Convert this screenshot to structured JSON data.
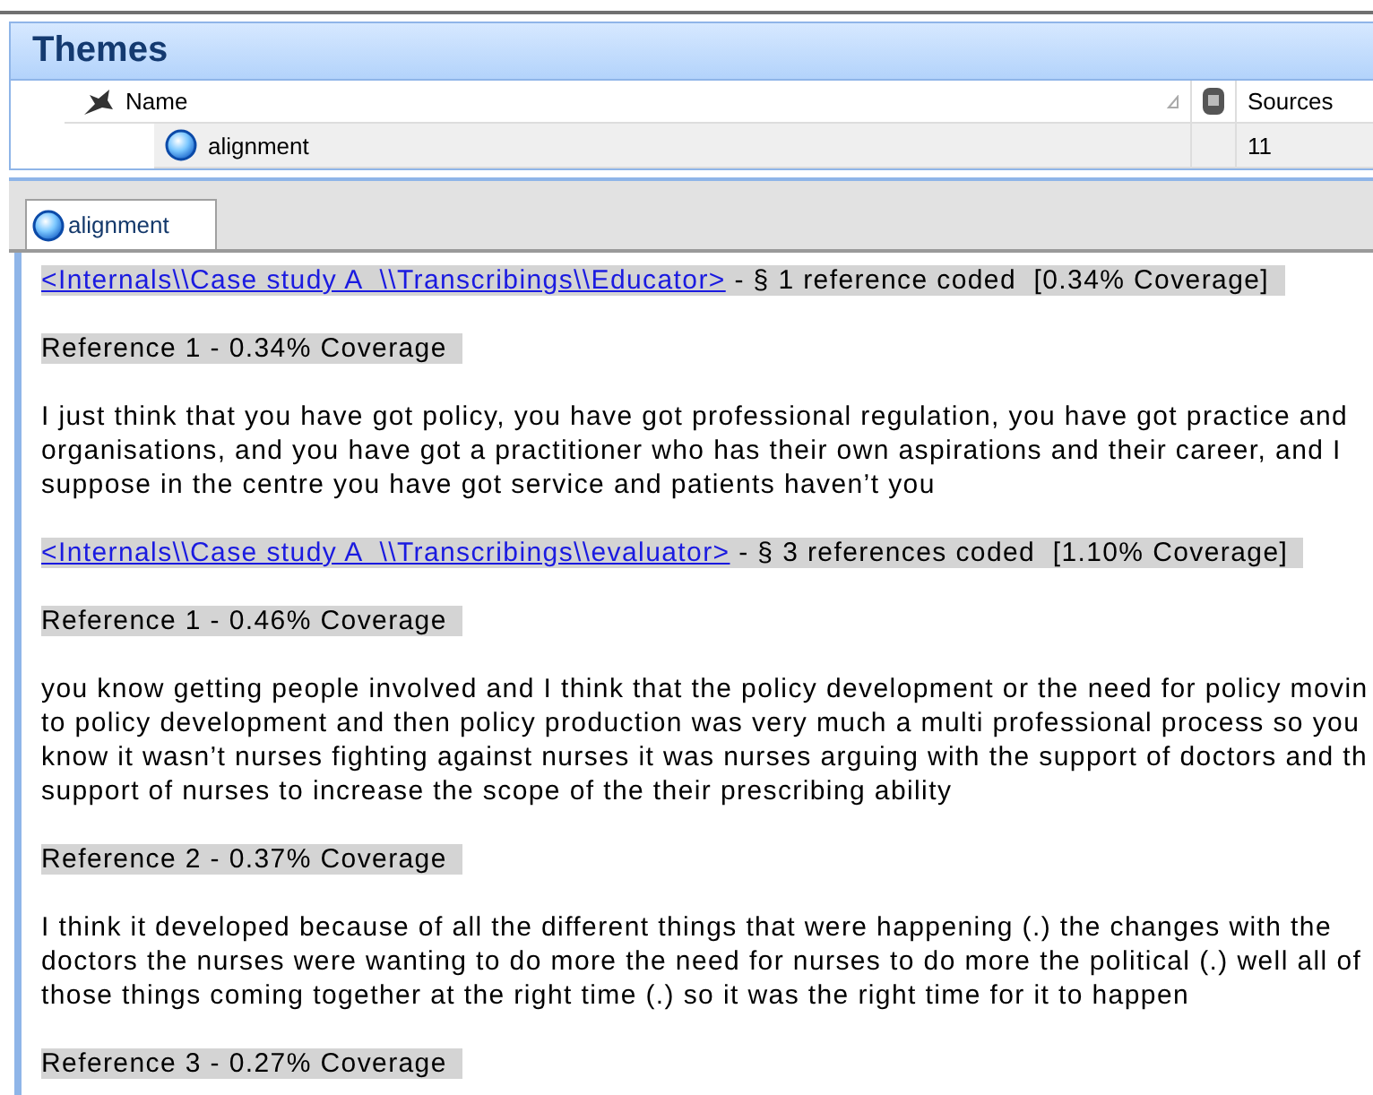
{
  "panel": {
    "title": "Themes",
    "columns": [
      {
        "label": "Name"
      },
      {
        "label": "Sources"
      }
    ],
    "rows": [
      {
        "name": "alignment",
        "sources": "11"
      }
    ]
  },
  "tabs": [
    {
      "label": "alignment",
      "selected": true
    }
  ],
  "document": {
    "blocks": [
      {
        "kind": "source",
        "link": "<Internals\\\\Case study A  \\\\Transcribings\\\\Educator>",
        "text": " - § 1 reference coded  [0.34% Coverage] "
      },
      {
        "kind": "reference",
        "text": "Reference 1 - 0.34% Coverage "
      },
      {
        "kind": "passage",
        "lines": [
          "I just think that you have got policy, you have got professional regulation, you have got practice and",
          "organisations, and you have got a practitioner who has their own aspirations and their career, and I",
          "suppose in the centre you have got service and patients haven’t you"
        ]
      },
      {
        "kind": "source",
        "link": "<Internals\\\\Case study A  \\\\Transcribings\\\\evaluator>",
        "text": " - § 3 references coded  [1.10% Coverage] "
      },
      {
        "kind": "reference",
        "text": "Reference 1 - 0.46% Coverage "
      },
      {
        "kind": "passage",
        "lines": [
          "you know getting people involved and I think that the policy development or the need for policy movin",
          "to policy development and then policy production was very much a multi professional process so you",
          "know it wasn’t nurses fighting against nurses it was nurses arguing with the support of doctors and th",
          "support of nurses to increase the scope of the their prescribing ability"
        ]
      },
      {
        "kind": "reference",
        "text": "Reference 2 - 0.37% Coverage "
      },
      {
        "kind": "passage",
        "lines": [
          "I think it developed because of all the different things that were happening (.) the changes with the",
          "doctors the nurses were wanting to do more the need for nurses to do more the political (.) well all of",
          "those things coming together at the right time (.) so it was the right time for it to happen"
        ]
      },
      {
        "kind": "reference",
        "text": "Reference 3 - 0.27% Coverage "
      }
    ]
  }
}
